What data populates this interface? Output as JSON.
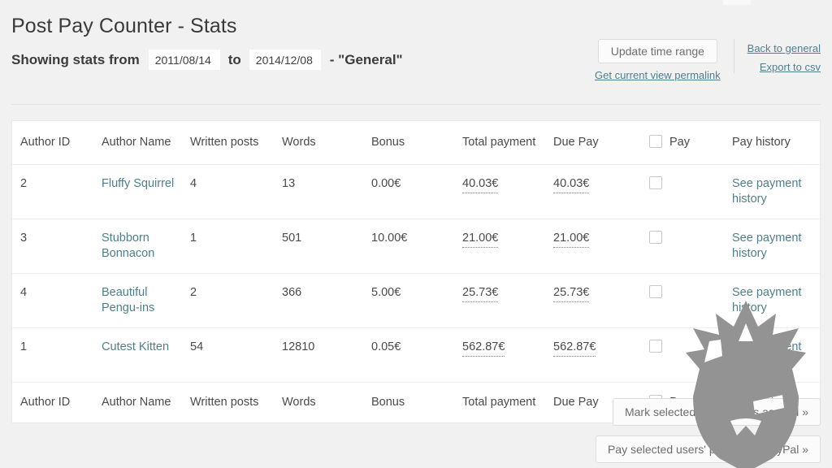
{
  "header": {
    "title": "Post Pay Counter - Stats",
    "showing_label": "Showing stats from",
    "date_from": "2011/08/14",
    "date_to": "2014/12/08",
    "to_label": "to",
    "suffix": "- \"General\""
  },
  "controls": {
    "update_button": "Update time range",
    "permalink_link": "Get current view permalink",
    "back_link": "Back to general",
    "export_link": "Export to csv"
  },
  "table": {
    "columns": [
      "Author ID",
      "Author Name",
      "Written posts",
      "Words",
      "Bonus",
      "Total payment",
      "Due Pay",
      "Pay",
      "Pay history"
    ],
    "pay_history_link": "See payment history",
    "rows": [
      {
        "author_id": "2",
        "author_name": "Fluffy Squirrel",
        "written_posts": "4",
        "words": "13",
        "bonus": "0.00€",
        "total_payment": "40.03€",
        "due_pay": "40.03€",
        "pay_checked": false,
        "pay_history": "See payment history"
      },
      {
        "author_id": "3",
        "author_name": "Stubborn Bonnacon",
        "written_posts": "1",
        "words": "501",
        "bonus": "10.00€",
        "total_payment": "21.00€",
        "due_pay": "21.00€",
        "pay_checked": false,
        "pay_history": "See payment history"
      },
      {
        "author_id": "4",
        "author_name": "Beautiful Pengu-ins",
        "written_posts": "2",
        "words": "366",
        "bonus": "5.00€",
        "total_payment": "25.73€",
        "due_pay": "25.73€",
        "pay_checked": false,
        "pay_history": "See payment history"
      },
      {
        "author_id": "1",
        "author_name": "Cutest Kitten",
        "written_posts": "54",
        "words": "12810",
        "bonus": "0.05€",
        "total_payment": "562.87€",
        "due_pay": "562.87€",
        "pay_checked": false,
        "pay_history": "See payment history"
      }
    ]
  },
  "actions": {
    "mark_paid": "Mark selected users' posts as paid »",
    "pay_paypal": "Pay selected users' posts with PayPal »"
  },
  "colors": {
    "page_background": "#f1f1f1",
    "table_background": "#ffffff",
    "link": "#4e7f8c",
    "text": "#4a4a4a",
    "border": "#ededed",
    "watermark": "#939393"
  }
}
